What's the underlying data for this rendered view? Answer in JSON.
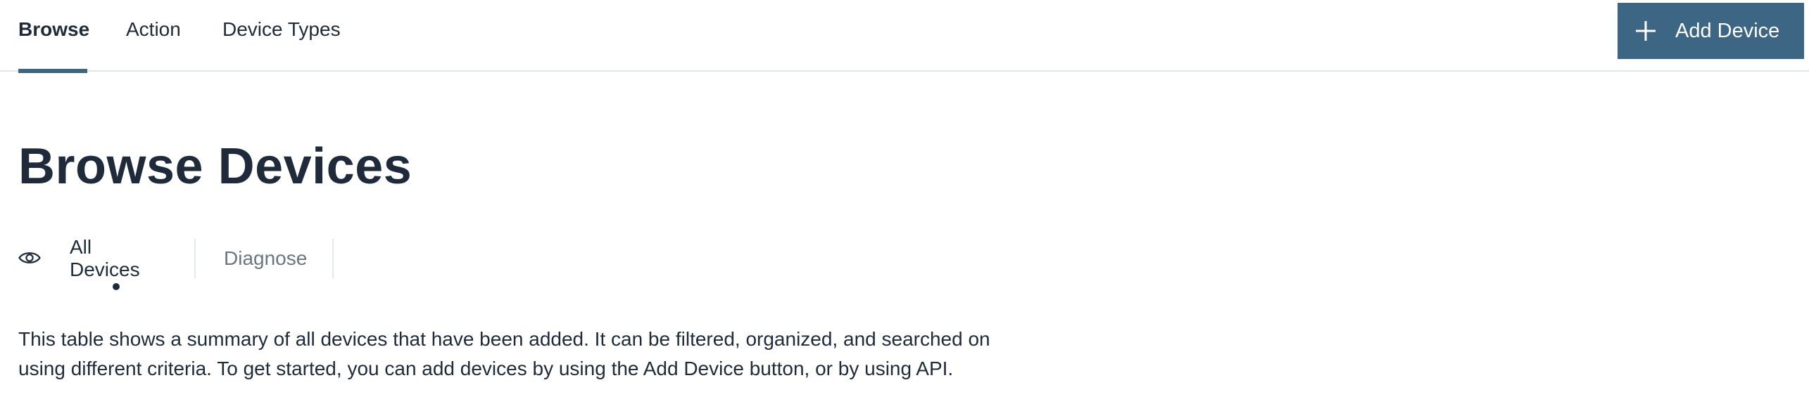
{
  "topnav": {
    "tabs": [
      {
        "label": "Browse",
        "active": true
      },
      {
        "label": "Action",
        "active": false
      },
      {
        "label": "Device Types",
        "active": false
      }
    ],
    "add_button": {
      "label": "Add Device",
      "icon": "plus-icon"
    }
  },
  "main": {
    "title": "Browse Devices",
    "subtabs": [
      {
        "label": "All Devices",
        "icon": "eye-icon",
        "active": true
      },
      {
        "label": "Diagnose",
        "active": false
      }
    ],
    "description": "This table shows a summary of all devices that have been added. It can be filtered, organized, and searched on using different criteria. To get started, you can add devices by using the Add Device button, or by using API."
  },
  "colors": {
    "accent": "#3d6584",
    "text": "#1f2b3a",
    "muted_text": "#6a7680",
    "divider": "#dfe7ec"
  }
}
